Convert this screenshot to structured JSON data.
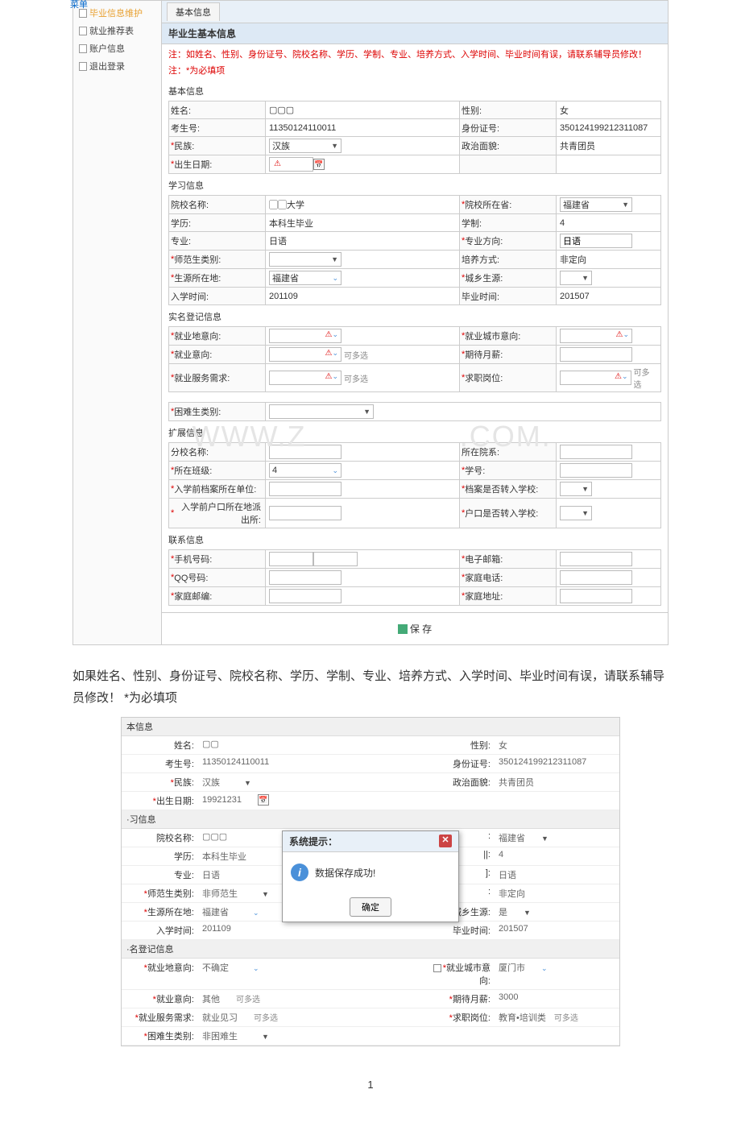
{
  "top_label": "菜单",
  "sidebar": {
    "items": [
      {
        "label": "毕业信息维护",
        "active": true
      },
      {
        "label": "就业推荐表",
        "active": false
      },
      {
        "label": "账户信息",
        "active": false
      },
      {
        "label": "退出登录",
        "active": false
      }
    ]
  },
  "tab": {
    "label": "基本信息"
  },
  "page_title": "毕业生基本信息",
  "warning_line1": "注：如姓名、性别、身份证号、院校名称、学历、学制、专业、培养方式、入学时间、毕业时间有误，请联系辅导员修改！",
  "warning_line2": "注：*为必填项",
  "sections": {
    "basic": {
      "title": "基本信息",
      "fields": {
        "name": {
          "label": "姓名:",
          "value": "▢▢▢"
        },
        "gender": {
          "label": "性别:",
          "value": "女"
        },
        "exam_no": {
          "label": "考生号:",
          "value": "11350124110011"
        },
        "id_no": {
          "label": "身份证号:",
          "value": "350124199212311087"
        },
        "ethnic": {
          "label": "民族:",
          "req": "*",
          "value": "汉族"
        },
        "political": {
          "label": "政治面貌:",
          "value": "共青团员"
        },
        "birth": {
          "label": "出生日期:",
          "req": "*",
          "value": ""
        }
      }
    },
    "study": {
      "title": "学习信息",
      "fields": {
        "school": {
          "label": "院校名称:",
          "value": "▢▢大学"
        },
        "school_prov": {
          "label": "院校所在省:",
          "req": "*",
          "value": "福建省"
        },
        "degree": {
          "label": "学历:",
          "value": "本科生毕业"
        },
        "system": {
          "label": "学制:",
          "value": "4"
        },
        "major": {
          "label": "专业:",
          "value": "日语"
        },
        "major_dir": {
          "label": "专业方向:",
          "req": "*",
          "value": "日语"
        },
        "normal_type": {
          "label": "师范生类别:",
          "req": "*",
          "value": ""
        },
        "train_mode": {
          "label": "培养方式:",
          "value": "非定向"
        },
        "origin": {
          "label": "生源所在地:",
          "req": "*",
          "value": "福建省"
        },
        "urban_rural": {
          "label": "城乡生源:",
          "req": "*",
          "value": ""
        },
        "enroll_time": {
          "label": "入学时间:",
          "value": "201109"
        },
        "grad_time": {
          "label": "毕业时间:",
          "value": "201507"
        }
      }
    },
    "realname": {
      "title": "实名登记信息",
      "fields": {
        "job_loc": {
          "label": "就业地意向:",
          "req": "*",
          "value": ""
        },
        "job_city": {
          "label": "就业城市意向:",
          "req": "*",
          "value": ""
        },
        "job_intent": {
          "label": "就业意向:",
          "req": "*",
          "value": "",
          "multi": "可多选"
        },
        "salary": {
          "label": "期待月薪:",
          "req": "*",
          "value": ""
        },
        "service_req": {
          "label": "就业服务需求:",
          "req": "*",
          "value": "",
          "multi": "可多选"
        },
        "position": {
          "label": "求职岗位:",
          "req": "*",
          "value": "",
          "multi": "可多选"
        },
        "difficulty": {
          "label": "困难生类别:",
          "req": "*",
          "value": ""
        }
      }
    },
    "extend": {
      "title": "扩展信息",
      "fields": {
        "branch": {
          "label": "分校名称:",
          "value": ""
        },
        "dept": {
          "label": "所在院系:",
          "value": ""
        },
        "class": {
          "label": "所在班级:",
          "req": "*",
          "value": "4"
        },
        "student_no": {
          "label": "学号:",
          "req": "*",
          "value": ""
        },
        "archive_unit": {
          "label": "入学前档案所在单位:",
          "req": "*",
          "value": ""
        },
        "archive_transfer": {
          "label": "档案是否转入学校:",
          "req": "*",
          "value": ""
        },
        "household": {
          "label": "入学前户口所在地派出所:",
          "req": "*",
          "value": ""
        },
        "household_transfer": {
          "label": "户口是否转入学校:",
          "req": "*",
          "value": ""
        }
      }
    },
    "contact": {
      "title": "联系信息",
      "fields": {
        "mobile": {
          "label": "手机号码:",
          "req": "*",
          "value": ""
        },
        "email": {
          "label": "电子邮箱:",
          "req": "*",
          "value": ""
        },
        "qq": {
          "label": "QQ号码:",
          "req": "*",
          "value": ""
        },
        "home_phone": {
          "label": "家庭电话:",
          "req": "*",
          "value": ""
        },
        "home_postcode": {
          "label": "家庭邮编:",
          "req": "*",
          "value": ""
        },
        "home_addr": {
          "label": "家庭地址:",
          "req": "*",
          "value": ""
        }
      }
    }
  },
  "save_button": "保 存",
  "instruction": "如果姓名、性别、身份证号、院校名称、学历、学制、专业、培养方式、入学时间、毕业时间有误，请联系辅导员修改！  *为必填项",
  "s2": {
    "sections": {
      "basic": {
        "title": "本信息",
        "rows": [
          {
            "l1": "姓名:",
            "v1": "▢▢",
            "l2": "性别:",
            "v2": "女"
          },
          {
            "l1": "考生号:",
            "v1": "11350124110011",
            "l2": "身份证号:",
            "v2": "350124199212311087"
          },
          {
            "l1": "民族:",
            "req1": "*",
            "v1": "汉族",
            "drop1": true,
            "l2": "政治面貌:",
            "v2": "共青团员"
          },
          {
            "l1": "出生日期:",
            "req1": "*",
            "v1": "19921231",
            "date1": true
          }
        ]
      },
      "study": {
        "title": "·习信息",
        "rows": [
          {
            "l1": "院校名称:",
            "v1": "▢▢▢",
            "l2": ":",
            "req2": "",
            "v2": "福建省",
            "drop2": true
          },
          {
            "l1": "学历:",
            "v1": "本科生毕业",
            "l2": "||:",
            "v2": "4"
          },
          {
            "l1": "专业:",
            "v1": "日语",
            "l2": "]:",
            "v2": "日语"
          },
          {
            "l1": "师范生类别:",
            "req1": "*",
            "v1": "非师范生",
            "drop1": true,
            "l2": ":",
            "v2": "非定向"
          },
          {
            "l1": "生源所在地:",
            "req1": "*",
            "v1": "福建省",
            "drop1b": true,
            "l2": "城乡生源:",
            "req2": "*",
            "v2": "是",
            "drop2": true
          },
          {
            "l1": "入学时间:",
            "v1": "201109",
            "l2": "毕业时间:",
            "v2": "201507"
          }
        ]
      },
      "realname": {
        "title": "·名登记信息",
        "rows": [
          {
            "l1": "就业地意向:",
            "req1": "*",
            "v1": "不确定",
            "drop1b": true,
            "l2": "就业城市意向:",
            "req2": "*",
            "v2": "厦门市",
            "drop2b": true,
            "check2": true
          },
          {
            "l1": "就业意向:",
            "req1": "*",
            "v1": "其他",
            "multi1": "可多选",
            "l2": "期待月薪:",
            "req2": "*",
            "v2": "3000"
          },
          {
            "l1": "就业服务需求:",
            "req1": "*",
            "v1": "就业见习",
            "multi1": "可多选",
            "l2": "求职岗位:",
            "req2": "*",
            "v2": "教育•培训类",
            "multi2": "可多选"
          },
          {
            "l1": "困难生类别:",
            "req1": "*",
            "v1": "非困难生",
            "drop1": true
          }
        ]
      }
    },
    "dialog": {
      "title": "系统提示：",
      "message": "数据保存成功!",
      "ok": "确定"
    }
  },
  "watermark1": "WWW.Z",
  "watermark2": ".COM.",
  "page_number": "1"
}
